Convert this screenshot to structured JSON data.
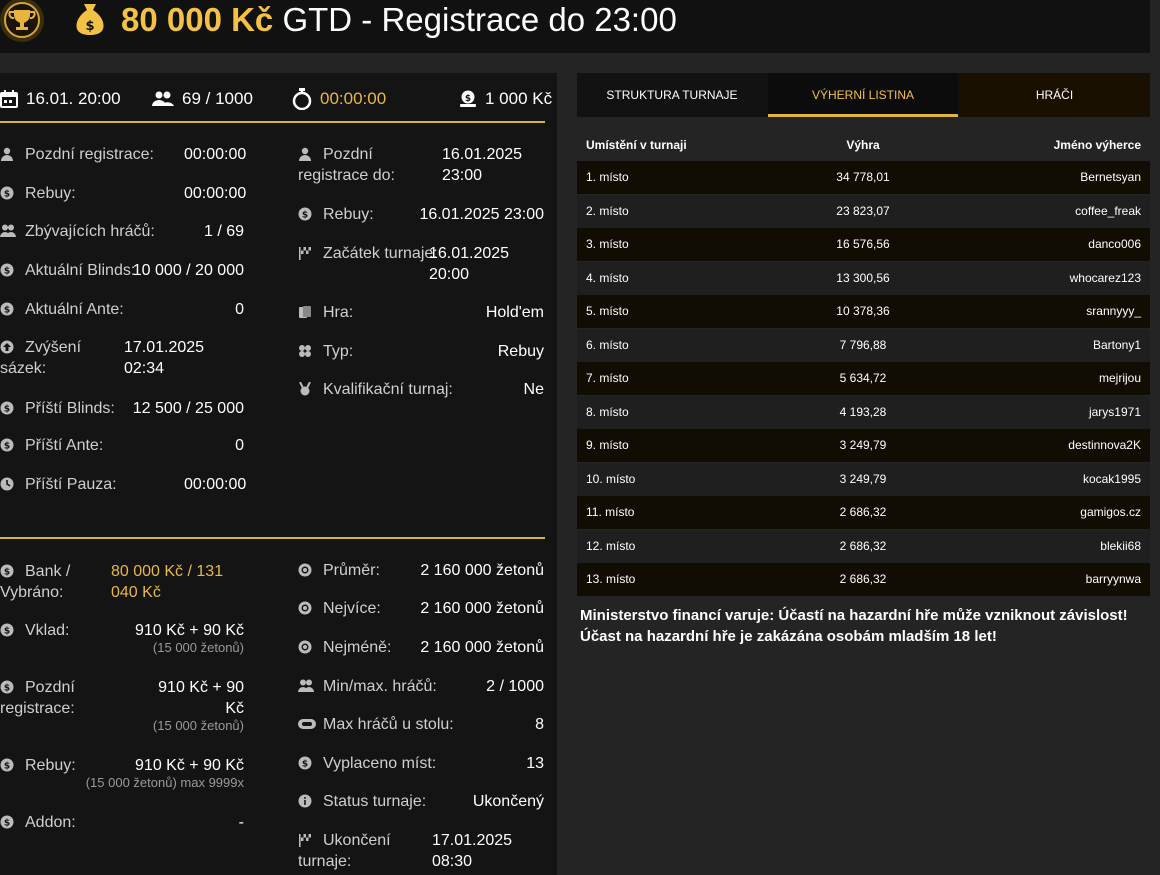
{
  "header": {
    "amount": "80 000 Kč",
    "title": "GTD - Registrace do 23:00"
  },
  "topbar": {
    "date": "16.01. 20:00",
    "players": "69 / 1000",
    "timer": "00:00:00",
    "buyin": "1 000 Kč"
  },
  "left_col": [
    {
      "label": "Pozdní registrace:",
      "value": "00:00:00"
    },
    {
      "label": "Rebuy:",
      "value": "00:00:00"
    },
    {
      "label": "Zbývajících hráčů:",
      "value": "1 / 69"
    },
    {
      "label": "Aktuální Blinds:",
      "value": "10 000 / 20 000"
    },
    {
      "label": "Aktuální Ante:",
      "value": "0"
    },
    {
      "label": "Zvýšení sázek:",
      "value": "17.01.2025 02:34"
    },
    {
      "label": "Příští Blinds:",
      "value": "12 500 / 25 000"
    },
    {
      "label": "Příští Ante:",
      "value": "0"
    },
    {
      "label": "Příští Pauza:",
      "value": "00:00:00"
    }
  ],
  "right_col": [
    {
      "label": "Pozdní registrace do:",
      "value": "16.01.2025 23:00"
    },
    {
      "label": "Rebuy:",
      "value": "16.01.2025 23:00"
    },
    {
      "label": "Začátek turnaje:",
      "value": "16.01.2025 20:00"
    },
    {
      "label": "Hra:",
      "value": "Hold'em"
    },
    {
      "label": "Typ:",
      "value": "Rebuy"
    },
    {
      "label": "Kvalifikační turnaj:",
      "value": "Ne"
    }
  ],
  "bottom_left": [
    {
      "label": "Bank / Vybráno:",
      "value": "80 000 Kč / 131 040 Kč",
      "sub": ""
    },
    {
      "label": "Vklad:",
      "value": "910 Kč + 90 Kč",
      "sub": "(15 000 žetonů)"
    },
    {
      "label": "Pozdní registrace:",
      "value": "910 Kč + 90 Kč",
      "sub": "(15 000 žetonů)"
    },
    {
      "label": "Rebuy:",
      "value": "910 Kč + 90 Kč",
      "sub": "(15 000 žetonů) max 9999x"
    },
    {
      "label": "Addon:",
      "value": "-",
      "sub": ""
    }
  ],
  "bottom_right": [
    {
      "label": "Průměr:",
      "value": "2 160 000 žetonů"
    },
    {
      "label": "Nejvíce:",
      "value": "2 160 000 žetonů"
    },
    {
      "label": "Nejméně:",
      "value": "2 160 000 žetonů"
    },
    {
      "label": "Min/max. hráčů:",
      "value": "2 / 1000"
    },
    {
      "label": "Max hráčů u stolu:",
      "value": "8"
    },
    {
      "label": "Vyplaceno míst:",
      "value": "13"
    },
    {
      "label": "Status turnaje:",
      "value": "Ukončený"
    },
    {
      "label": "Ukončení turnaje:",
      "value": "17.01.2025 08:30"
    }
  ],
  "tabs": [
    "STRUKTURA TURNAJE",
    "VÝHERNÍ LISTINA",
    "HRÁČI"
  ],
  "results": {
    "headers": [
      "Umístění v turnaji",
      "Výhra",
      "Jméno výherce"
    ],
    "rows": [
      [
        "1. místo",
        "34 778,01",
        "Bernetsyan"
      ],
      [
        "2. místo",
        "23 823,07",
        "coffee_freak"
      ],
      [
        "3. místo",
        "16 576,56",
        "danco006"
      ],
      [
        "4. místo",
        "13 300,56",
        "whocarez123"
      ],
      [
        "5. místo",
        "10 378,36",
        "srannyyy_"
      ],
      [
        "6. místo",
        "7 796,88",
        "Bartony1"
      ],
      [
        "7. místo",
        "5 634,72",
        "mejrijou"
      ],
      [
        "8. místo",
        "4 193,28",
        "jarys1971"
      ],
      [
        "9. místo",
        "3 249,79",
        "destinnova2K"
      ],
      [
        "10. místo",
        "3 249,79",
        "kocak1995"
      ],
      [
        "11. místo",
        "2 686,32",
        "gamigos.cz"
      ],
      [
        "12. místo",
        "2 686,32",
        "blekii68"
      ],
      [
        "13. místo",
        "2 686,32",
        "barryynwa"
      ]
    ]
  },
  "warning": {
    "line1": "Ministerstvo financí varuje: Účastí na hazardní hře může vzniknout závislost!",
    "line2": "Účast na hazardní hře je zakázána osobám mladším 18 let!"
  },
  "colors": {
    "accent": "#f3c143",
    "bg": "#242424",
    "panel": "#141414"
  }
}
